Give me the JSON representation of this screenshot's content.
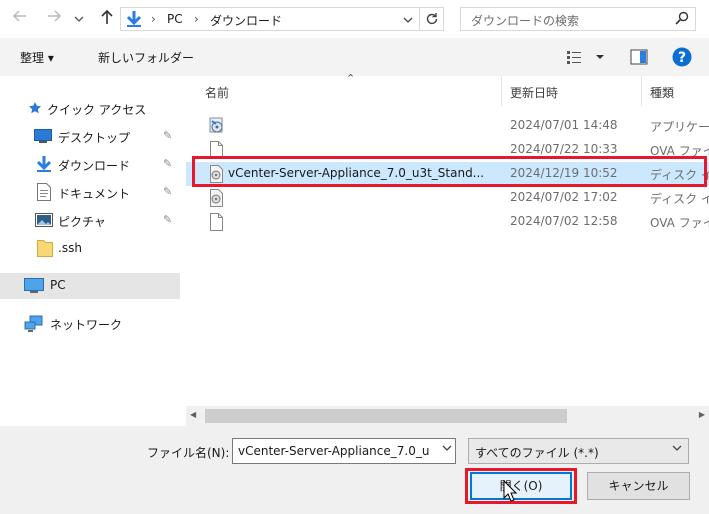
{
  "address_bar": {
    "breadcrumb": [
      "PC",
      "ダウンロード"
    ],
    "search_placeholder": "ダウンロードの検索"
  },
  "toolbar": {
    "organize_label": "整理 ▾",
    "new_folder_label": "新しいフォルダー"
  },
  "nav_pane": {
    "quick_access": "クイック アクセス",
    "items": [
      {
        "label": "デスクトップ",
        "pinned": true
      },
      {
        "label": "ダウンロード",
        "pinned": true
      },
      {
        "label": "ドキュメント",
        "pinned": true
      },
      {
        "label": "ピクチャ",
        "pinned": true
      },
      {
        "label": ".ssh",
        "pinned": false
      }
    ],
    "pc": "PC",
    "network": "ネットワーク"
  },
  "file_list": {
    "columns": {
      "name": "名前",
      "modified": "更新日時",
      "type": "種類"
    },
    "rows": [
      {
        "name": "",
        "date": "2024/07/01 14:48",
        "type": "アプリケーション"
      },
      {
        "name": "",
        "date": "2024/07/22 10:33",
        "type": "OVA ファイル"
      },
      {
        "name": "vCenter-Server-Appliance_7.0_u3t_Stand...",
        "date": "2024/12/19 10:52",
        "type": "ディスク イメージ",
        "selected": true
      },
      {
        "name": "",
        "date": "2024/07/02 17:02",
        "type": "ディスク イメージ"
      },
      {
        "name": "",
        "date": "2024/07/02 12:58",
        "type": "OVA ファイル"
      }
    ]
  },
  "bottom": {
    "filename_label": "ファイル名(N):",
    "filename_value": "vCenter-Server-Appliance_7.0_u",
    "filter_value": "すべてのファイル (*.*)",
    "open_label": "開く(O)",
    "cancel_label": "キャンセル"
  },
  "colors": {
    "highlight": "#e8182c",
    "selection": "#cce8ff",
    "accent": "#0078d7"
  }
}
